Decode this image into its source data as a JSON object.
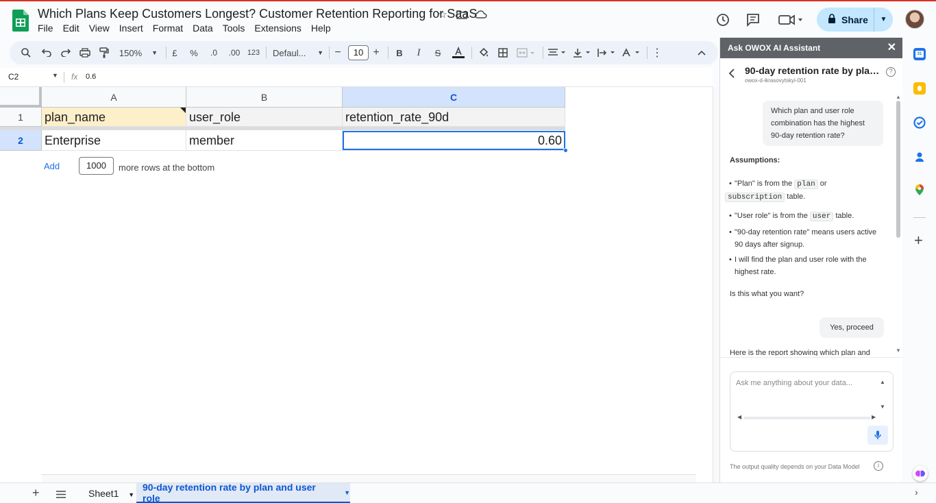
{
  "doc": {
    "title": "Which Plans Keep Customers Longest? Customer Retention Reporting for SaaS",
    "menu": [
      "File",
      "Edit",
      "View",
      "Insert",
      "Format",
      "Data",
      "Tools",
      "Extensions",
      "Help"
    ],
    "share_label": "Share"
  },
  "toolbar": {
    "zoom": "150%",
    "currency": "£",
    "percent": "%",
    "decrease_decimal": ".0",
    "increase_decimal": ".00",
    "number_format": "123",
    "font": "Defaul...",
    "font_size": "10",
    "bold": "B",
    "italic": "I",
    "strike": "S"
  },
  "formula_bar": {
    "cell_ref": "C2",
    "value": "0.6"
  },
  "grid": {
    "columns": [
      "A",
      "B",
      "C"
    ],
    "row_numbers": [
      "1",
      "2"
    ],
    "header_row": [
      "plan_name",
      "user_role",
      "retention_rate_90d"
    ],
    "data_row": [
      "Enterprise",
      "member",
      "0.60"
    ],
    "add_label": "Add",
    "add_rows_count": "1000",
    "add_rows_text": "more rows at the bottom"
  },
  "sheets": {
    "tab1": "Sheet1",
    "tab2": "90-day retention rate by plan and user role"
  },
  "panel": {
    "header": "Ask OWOX AI Assistant",
    "chat_title": "90-day retention rate by plan ...",
    "chat_sub": "owox-d-ikrasovytskyi-001",
    "user_question": "Which plan and user role combination has the highest 90-day retention rate?",
    "assumptions_title": "Assumptions:",
    "bullet1_pre": "\"Plan\" is from the",
    "bullet1_code1": "plan",
    "bullet1_mid": "or",
    "bullet1_code2": "subscription",
    "bullet1_post": "table.",
    "bullet2_pre": "\"User role\" is from the",
    "bullet2_code": "user",
    "bullet2_post": "table.",
    "bullet3": "\"90-day retention rate\" means users active 90 days after signup.",
    "bullet4": "I will find the plan and user role with the highest rate.",
    "confirm_question": "Is this what you want?",
    "user_reply": "Yes, proceed",
    "partial_reply": "Here is the report showing which plan and",
    "input_placeholder": "Ask me anything about your data...",
    "footer_note": "The output quality depends on your Data Model"
  },
  "colors": {
    "accent": "#1a73e8",
    "share_bg": "#c2e7ff",
    "selected_header": "#d3e3fd",
    "highlight_cell": "#fdefc9"
  }
}
